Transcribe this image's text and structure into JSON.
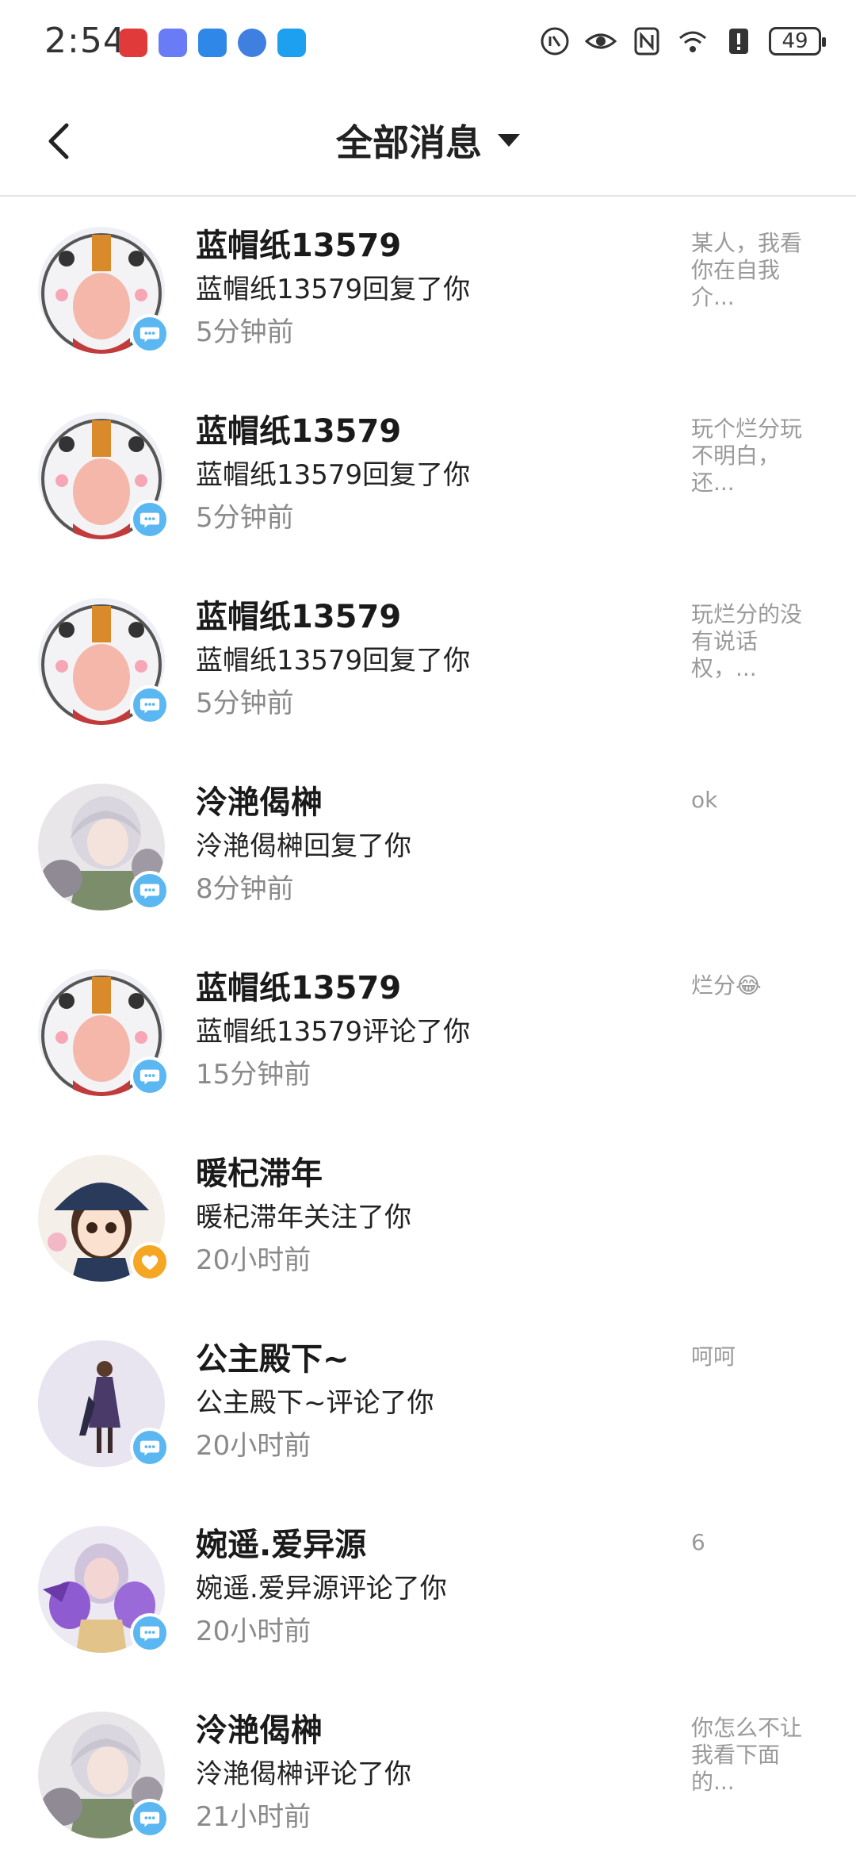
{
  "status": {
    "time": "2:54",
    "battery": "49",
    "app_icons": [
      "huawei-icon",
      "music-icon",
      "cloud-icon",
      "browser-icon",
      "search-app-icon"
    ],
    "sys_icons": [
      "hd-call-icon",
      "eye-icon",
      "nfc-icon",
      "wifi-icon",
      "alert-icon"
    ]
  },
  "header": {
    "title": "全部消息"
  },
  "messages": [
    {
      "name": "蓝帽纸13579",
      "action": "蓝帽纸13579回复了你",
      "time": "5分钟前",
      "preview": "某人，我看你在自我介...",
      "badge": "comment",
      "avatar": "white-hood"
    },
    {
      "name": "蓝帽纸13579",
      "action": "蓝帽纸13579回复了你",
      "time": "5分钟前",
      "preview": "玩个烂分玩不明白，还...",
      "badge": "comment",
      "avatar": "white-hood"
    },
    {
      "name": "蓝帽纸13579",
      "action": "蓝帽纸13579回复了你",
      "time": "5分钟前",
      "preview": "玩烂分的没有说话权，...",
      "badge": "comment",
      "avatar": "white-hood"
    },
    {
      "name": "泠滟偈榊",
      "action": "泠滟偈榊回复了你",
      "time": "8分钟前",
      "preview": "ok",
      "badge": "comment",
      "avatar": "silver-hair"
    },
    {
      "name": "蓝帽纸13579",
      "action": "蓝帽纸13579评论了你",
      "time": "15分钟前",
      "preview": "烂分😂",
      "badge": "comment",
      "avatar": "white-hood"
    },
    {
      "name": "暖杞滞年",
      "action": "暖杞滞年关注了你",
      "time": "20小时前",
      "preview": "",
      "badge": "follow",
      "avatar": "cap-girl"
    },
    {
      "name": "公主殿下~",
      "action": "公主殿下~评论了你",
      "time": "20小时前",
      "preview": "呵呵",
      "badge": "comment",
      "avatar": "princess"
    },
    {
      "name": "婉遥.爱异源",
      "action": "婉遥.爱异源评论了你",
      "time": "20小时前",
      "preview": "6",
      "badge": "comment",
      "avatar": "purple-armor"
    },
    {
      "name": "泠滟偈榊",
      "action": "泠滟偈榊评论了你",
      "time": "21小时前",
      "preview": "你怎么不让我看下面的...",
      "badge": "comment",
      "avatar": "silver-hair"
    }
  ]
}
